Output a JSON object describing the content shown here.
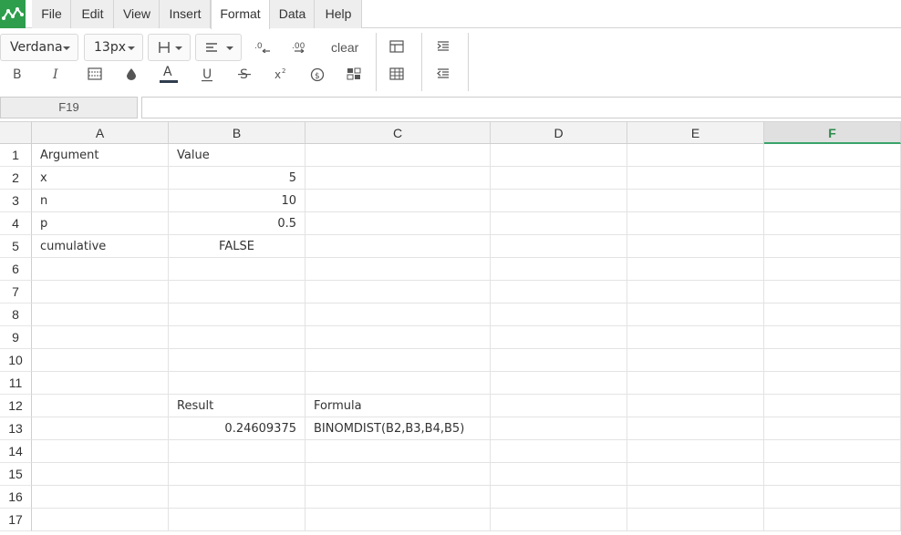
{
  "menu": {
    "items": [
      {
        "label": "File"
      },
      {
        "label": "Edit"
      },
      {
        "label": "View"
      },
      {
        "label": "Insert"
      },
      {
        "label": "Format",
        "active": true
      },
      {
        "label": "Data"
      },
      {
        "label": "Help"
      }
    ]
  },
  "toolbar": {
    "font_family": "Verdana",
    "font_size": "13px",
    "clear_label": "clear"
  },
  "formula_bar": {
    "cell_ref": "F19",
    "formula": ""
  },
  "grid": {
    "columns": [
      "A",
      "B",
      "C",
      "D",
      "E",
      "F"
    ],
    "selected_column": "F",
    "rows": [
      "1",
      "2",
      "3",
      "4",
      "5",
      "6",
      "7",
      "8",
      "9",
      "10",
      "11",
      "12",
      "13",
      "14",
      "15",
      "16",
      "17"
    ],
    "cells": {
      "A1": "Argument",
      "B1": "Value",
      "A2": "x",
      "B2": "5",
      "A3": "n",
      "B3": "10",
      "A4": "p",
      "B4": "0.5",
      "A5": "cumulative",
      "B5": "FALSE",
      "B12": "Result",
      "C12": "Formula",
      "B13": "0.24609375",
      "C13": "BINOMDIST(B2,B3,B4,B5)"
    }
  },
  "colors": {
    "accent": "#2e9e4c",
    "selected_header_text": "#2b8a4a"
  }
}
